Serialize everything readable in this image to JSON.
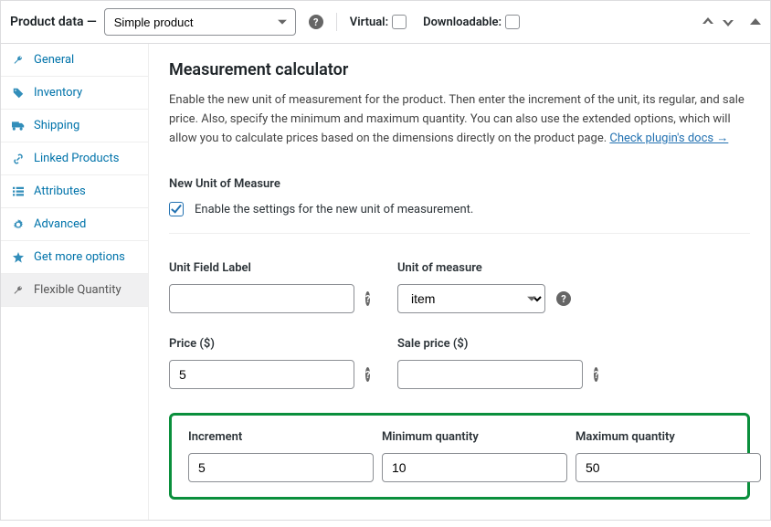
{
  "header": {
    "title": "Product data —",
    "product_type": "Simple product",
    "virtual_label": "Virtual:",
    "downloadable_label": "Downloadable:"
  },
  "tabs": [
    {
      "label": "General",
      "icon": "wrench"
    },
    {
      "label": "Inventory",
      "icon": "tag"
    },
    {
      "label": "Shipping",
      "icon": "truck"
    },
    {
      "label": "Linked Products",
      "icon": "link"
    },
    {
      "label": "Attributes",
      "icon": "list"
    },
    {
      "label": "Advanced",
      "icon": "gear"
    },
    {
      "label": "Get more options",
      "icon": "star"
    },
    {
      "label": "Flexible Quantity",
      "icon": "wrench",
      "active": true
    }
  ],
  "main": {
    "heading": "Measurement calculator",
    "description_1": "Enable the new unit of measurement for the product. Then enter the increment of the unit, its regular, and sale price. Also, specify the minimum and maximum quantity. You can also use the extended options, which will allow you to calculate prices based on the dimensions directly on the product page. ",
    "docs_link": "Check plugin's docs →",
    "section_title": "New Unit of Measure",
    "enable_text": "Enable the settings for the new unit of measurement.",
    "enable_checked": true,
    "fields": {
      "unit_field_label": {
        "label": "Unit Field Label",
        "value": ""
      },
      "unit_of_measure": {
        "label": "Unit of measure",
        "value": "item"
      },
      "price": {
        "label": "Price ($)",
        "value": "5"
      },
      "sale_price": {
        "label": "Sale price ($)",
        "value": ""
      },
      "increment": {
        "label": "Increment",
        "value": "5"
      },
      "min_qty": {
        "label": "Minimum quantity",
        "value": "10"
      },
      "max_qty": {
        "label": "Maximum quantity",
        "value": "50"
      }
    }
  }
}
